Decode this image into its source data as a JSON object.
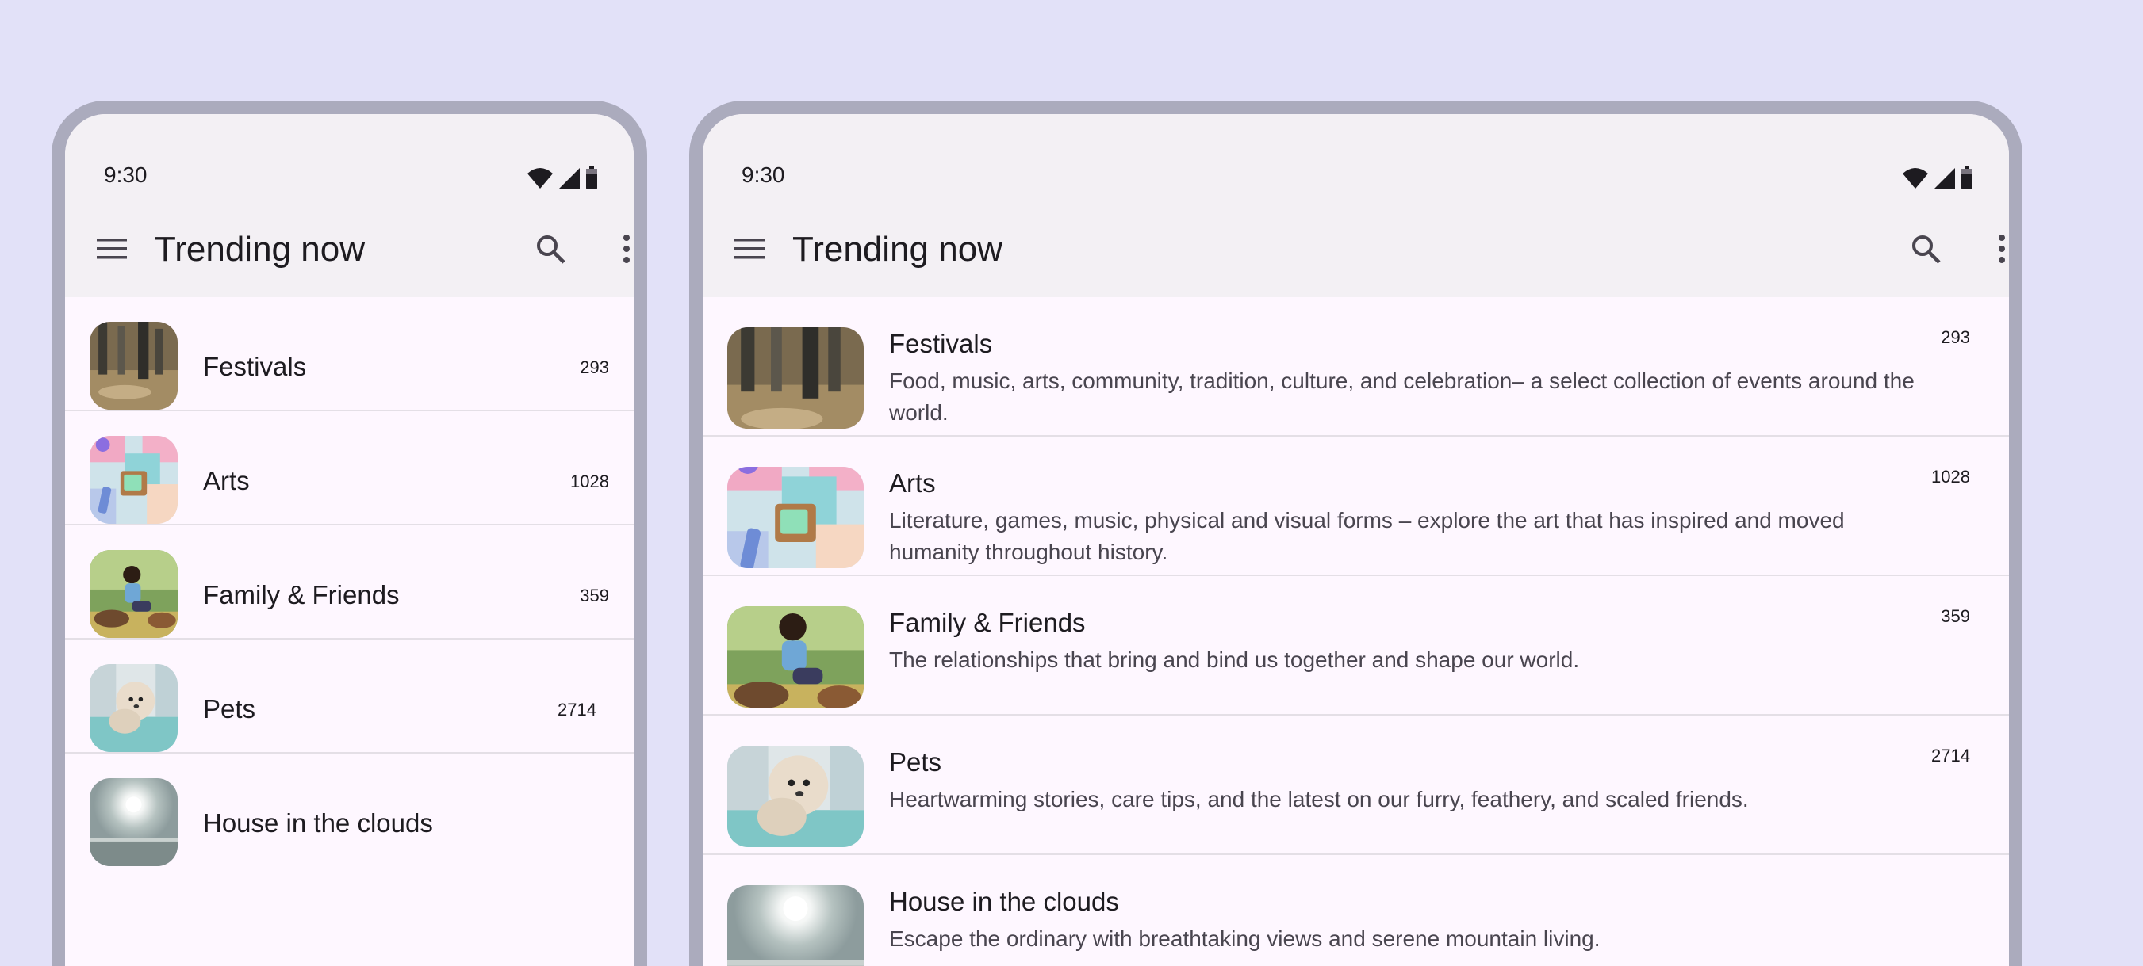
{
  "status": {
    "time": "9:30",
    "icons": [
      "wifi-icon",
      "signal-icon",
      "battery-icon"
    ]
  },
  "appbar": {
    "title": "Trending now",
    "icons": [
      "menu-icon",
      "search-icon",
      "more-vert-icon"
    ]
  },
  "colors": {
    "background": "#e2e1f8",
    "device_frame": "#ababbd",
    "surface": "#fef7ff",
    "topbar": "#f3f0f4",
    "divider": "#e4dfe6"
  },
  "phone": {
    "items": [
      {
        "title": "Festivals",
        "count": "293"
      },
      {
        "title": "Arts",
        "count": "1028"
      },
      {
        "title": "Family & Friends",
        "count": "359"
      },
      {
        "title": "Pets",
        "count": "2714"
      },
      {
        "title": "House in the clouds",
        "count": ""
      }
    ]
  },
  "tablet": {
    "items": [
      {
        "title": "Festivals",
        "description": "Food, music, arts, community, tradition, culture, and celebration– a select collection of events around the world.",
        "count": "293"
      },
      {
        "title": "Arts",
        "description": "Literature, games, music, physical and visual forms – explore the art that has inspired and moved humanity throughout history.",
        "count": "1028"
      },
      {
        "title": "Family & Friends",
        "description": "The relationships that bring and bind us together and shape our world.",
        "count": "359"
      },
      {
        "title": "Pets",
        "description": "Heartwarming stories, care tips, and the latest on our furry, feathery, and scaled friends.",
        "count": "2714"
      },
      {
        "title": "House in the clouds",
        "description": "Escape the ordinary with breathtaking views and serene mountain living.",
        "count": ""
      }
    ]
  }
}
